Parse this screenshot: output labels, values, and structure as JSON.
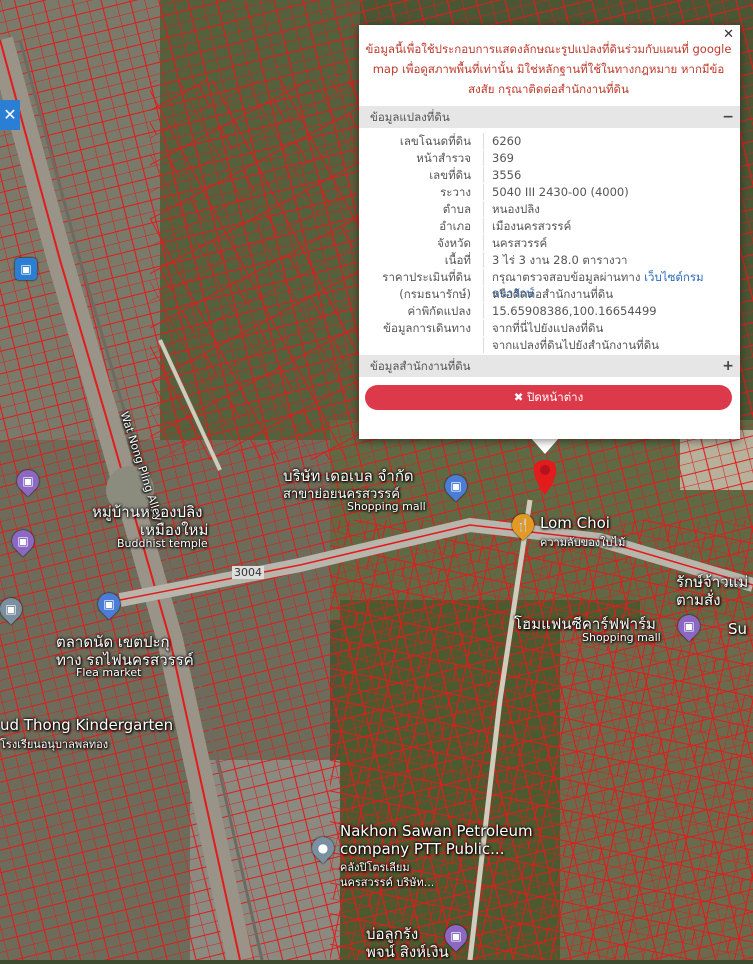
{
  "map": {
    "labels": [
      {
        "id": "company",
        "text": "บริษัท เดอเบล จำกัด"
      },
      {
        "id": "company_branch",
        "text": "สาขาย่อยนครสวรรค์"
      },
      {
        "id": "shopping1",
        "text": "Shopping mall"
      },
      {
        "id": "village",
        "text": "หมู่บ้านหนองปลิง"
      },
      {
        "id": "village2",
        "text": "เหมืองใหม่"
      },
      {
        "id": "temple",
        "text": "Buddhist temple"
      },
      {
        "id": "lom_choi",
        "text": "Lom Choi"
      },
      {
        "id": "lom_choi_th",
        "text": "ความลับของใบไม้"
      },
      {
        "id": "road",
        "text": "3004"
      },
      {
        "id": "alley",
        "text": "Wat Nong Pling Alley"
      },
      {
        "id": "rak",
        "text": "รักษ์จ้าวแม่"
      },
      {
        "id": "rak2",
        "text": "ตามสั่ง"
      },
      {
        "id": "homefancy",
        "text": "โฮมแฟนซีคาร์ฟฟาร์ม"
      },
      {
        "id": "shopping2",
        "text": "Shopping mall"
      },
      {
        "id": "su",
        "text": "Su"
      },
      {
        "id": "market",
        "text": "ตลาดนัด เขตปะกุ"
      },
      {
        "id": "market2",
        "text": "ทาง รถไฟนครสวรรค์"
      },
      {
        "id": "flea",
        "text": "Flea market"
      },
      {
        "id": "kinder",
        "text": "ud Thong Kindergarten"
      },
      {
        "id": "kinder_th",
        "text": "โรงเรียนอนุบาลพลทอง"
      },
      {
        "id": "ptt",
        "text": "Nakhon Sawan Petroleum"
      },
      {
        "id": "ptt2",
        "text": "company PTT Public..."
      },
      {
        "id": "ptt_th",
        "text": "คลังปิโตรเลียม"
      },
      {
        "id": "ptt_th2",
        "text": "นครสวรรค์ บริษัท..."
      },
      {
        "id": "bottom1",
        "text": "บ่อลูกรัง"
      },
      {
        "id": "bottom2",
        "text": "พจน์ สิงห์เงิน"
      }
    ]
  },
  "popup": {
    "close_symbol": "✕",
    "disclaimer": "ข้อมูลนี้เพื่อใช้ประกอบการแสดงลักษณะรูปแปลงที่ดินร่วมกับแผนที่ google map เพื่อดูสภาพพื้นที่เท่านั้น มิใช่หลักฐานที่ใช้ในทางกฎหมาย หากมีข้อสงสัย กรุณาติดต่อสำนักงานที่ดิน",
    "section1_title": "ข้อมูลแปลงที่ดิน",
    "section1_sign": "−",
    "rows": [
      {
        "label": "เลขโฉนดที่ดิน",
        "value": "6260"
      },
      {
        "label": "หน้าสำรวจ",
        "value": "369"
      },
      {
        "label": "เลขที่ดิน",
        "value": "3556"
      },
      {
        "label": "ระวาง",
        "value": "5040 III 2430-00 (4000)"
      },
      {
        "label": "ตำบล",
        "value": "หนองปลิง"
      },
      {
        "label": "อำเภอ",
        "value": "เมืองนครสวรรค์"
      },
      {
        "label": "จังหวัด",
        "value": "นครสวรรค์"
      },
      {
        "label": "เนื้อที่",
        "value": "3 ไร่ 3 งาน 28.0 ตารางวา"
      }
    ],
    "price_label": "ราคาประเมินที่ดิน",
    "price_label2": "(กรมธนารักษ์)",
    "price_text": "กรุณาตรวจสอบข้อมูลผ่านทาง",
    "price_link": "เว็บไซต์กรมธนารักษ์",
    "price_text2": "หรือติดต่อสำนักงานที่ดิน",
    "coord_label": "ค่าพิกัดแปลง",
    "coord_value": "15.65908386,100.16654499",
    "travel_label": "ข้อมูลการเดินทาง",
    "travel_link1": "จากที่นี่ไปยังแปลงที่ดิน",
    "travel_link2": "จากแปลงที่ดินไปยังสำนักงานที่ดิน",
    "section2_title": "ข้อมูลสำนักงานที่ดิน",
    "section2_sign": "+",
    "close_button": "✖ ปิดหน้าต่าง"
  }
}
